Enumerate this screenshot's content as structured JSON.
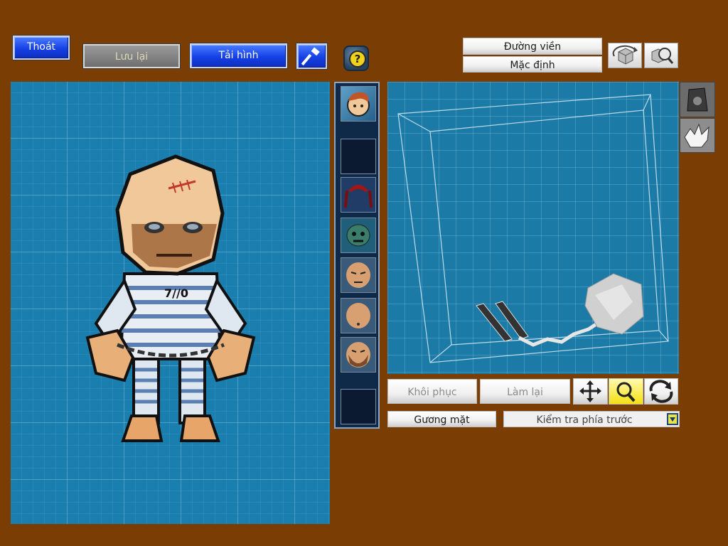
{
  "toolbar": {
    "exit_label": "Thoát",
    "save_label": "Lưu lại",
    "reload_label": "Tải hình",
    "help_glyph": "?"
  },
  "view_options": {
    "outline_label": "Đường viền",
    "default_label": "Mặc định"
  },
  "editor": {
    "restore_label": "Khôi phục",
    "redo_label": "Làm lại",
    "face_label": "Gương mặt",
    "check_select_value": "Kiểm tra phía trước"
  },
  "character": {
    "shirt_number": "7//0"
  },
  "parts_list": [
    {
      "name": "portrait",
      "icon": "portrait-icon"
    },
    {
      "name": "empty",
      "icon": "empty-slot"
    },
    {
      "name": "hair",
      "icon": "red-hair-icon"
    },
    {
      "name": "mask",
      "icon": "green-mask-icon"
    },
    {
      "name": "face-frown",
      "icon": "face-icon"
    },
    {
      "name": "face-plain",
      "icon": "face-icon"
    },
    {
      "name": "face-beard",
      "icon": "face-icon"
    },
    {
      "name": "empty",
      "icon": "empty-slot"
    }
  ],
  "colors": {
    "background": "#7a3e05",
    "grid": "#1a7fae",
    "button_blue": "#1640e6"
  }
}
